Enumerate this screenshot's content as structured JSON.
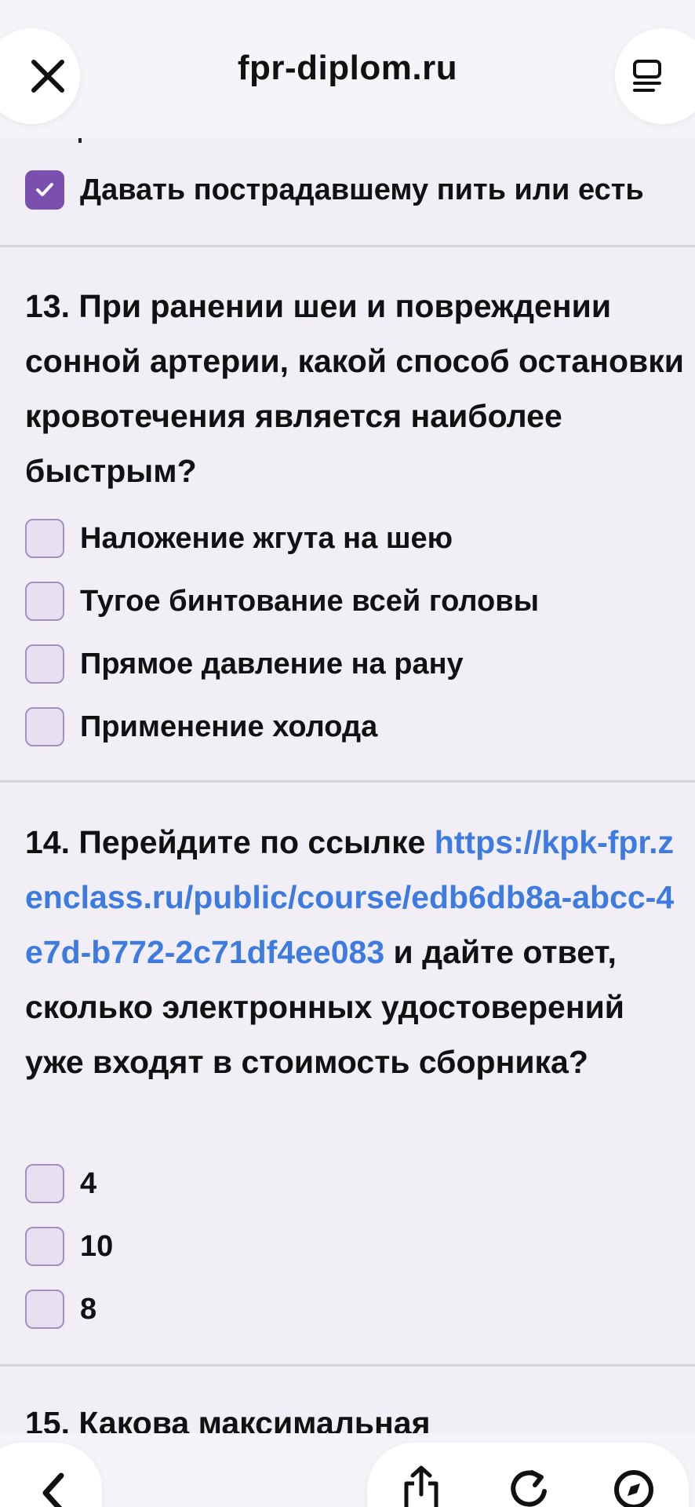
{
  "browser": {
    "site_title": "fpr-diplom.ru",
    "icons": {
      "close": "close-icon",
      "menu": "reader-menu-icon",
      "back": "chevron-left-icon",
      "share": "share-icon",
      "reload": "reload-icon",
      "safari": "compass-icon"
    }
  },
  "q12": {
    "option_checked": "Давать пострадавшему пить или есть"
  },
  "q13": {
    "text": "13. При ранении шеи и повреждении сонной артерии, какой способ остановки кровотечения является наиболее быстрым?",
    "options": [
      "Наложение жгута на шею",
      "Тугое бинтование всей головы",
      "Прямое давление на рану",
      "Применение холода"
    ]
  },
  "q14": {
    "text_before": "14. Перейдите по ссылке ",
    "link": "https://kpk-fpr.zenclass.ru/public/course/edb6db8a-abcc-4e7d-b772-2c71df4ee083",
    "text_after": " и дайте ответ, сколько электронных удостоверений уже входят в стоимость сборника?",
    "options": [
      "4",
      "10",
      "8"
    ]
  },
  "q15": {
    "text_partial": "15. Какова максимальная"
  },
  "colors": {
    "accent": "#7a4fae",
    "link": "#3d7be0",
    "background": "#f1eef6"
  }
}
